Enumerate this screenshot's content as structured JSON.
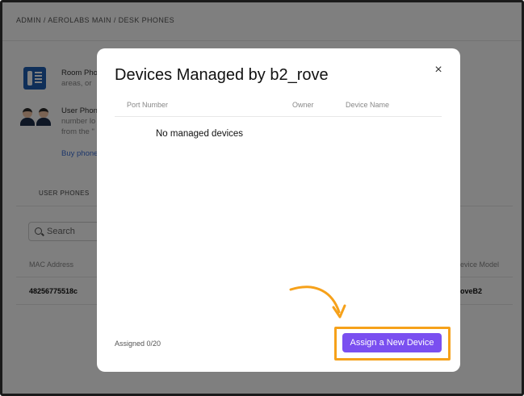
{
  "background": {
    "breadcrumb": "ADMIN / AEROLABS MAIN / DESK PHONES",
    "room_phones": {
      "title": "Room Pho",
      "subtitle": "areas, or"
    },
    "user_phones": {
      "title": "User Phon",
      "line1": "number lo",
      "line2": "from the \""
    },
    "buy_link": "Buy phone",
    "tab_user_phones": "USER PHONES",
    "search_placeholder": "Search",
    "columns": {
      "mac_address": "MAC Address",
      "device_model": "evice Model"
    },
    "row": {
      "mac": "48256775518c",
      "model": "oveB2"
    }
  },
  "modal": {
    "title": "Devices Managed by b2_rove",
    "close_label": "×",
    "columns": [
      "Port Number",
      "Owner",
      "Device Name"
    ],
    "empty_message": "No managed devices",
    "assigned_count": "Assigned 0/20",
    "assign_button": "Assign a New Device"
  },
  "colors": {
    "accent": "#7a4ff0",
    "highlight": "#f6a11a",
    "overlay": "rgba(0,0,0,0.5)"
  }
}
